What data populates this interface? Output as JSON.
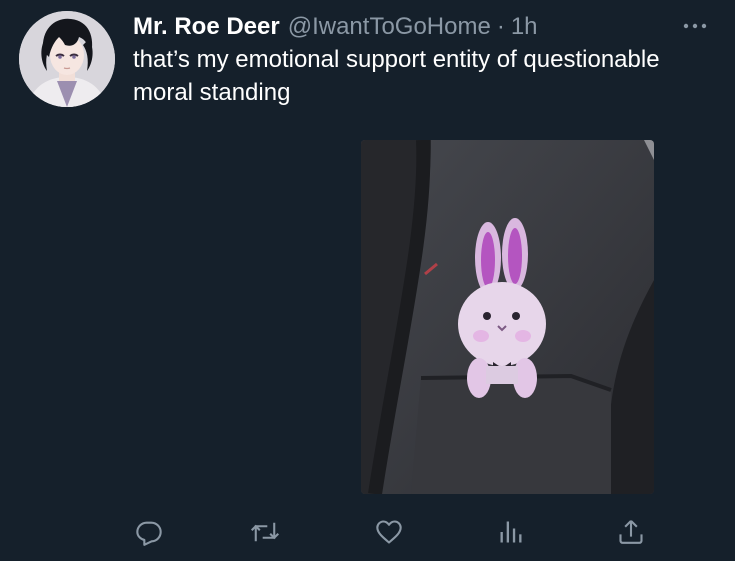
{
  "tweet": {
    "display_name": "Mr. Roe Deer",
    "handle": "@IwantToGoHome",
    "separator": "·",
    "timestamp": "1h",
    "text": "that’s my emotional support entity of questionable moral standing"
  },
  "media": {
    "description_icon": "photo"
  },
  "actions": {
    "reply_icon": "reply-icon",
    "retweet_icon": "retweet-icon",
    "like_icon": "heart-icon",
    "analytics_icon": "analytics-icon",
    "share_icon": "share-icon"
  },
  "colors": {
    "background": "#15202b",
    "text_primary": "#ffffff",
    "text_secondary": "#8b98a5"
  }
}
